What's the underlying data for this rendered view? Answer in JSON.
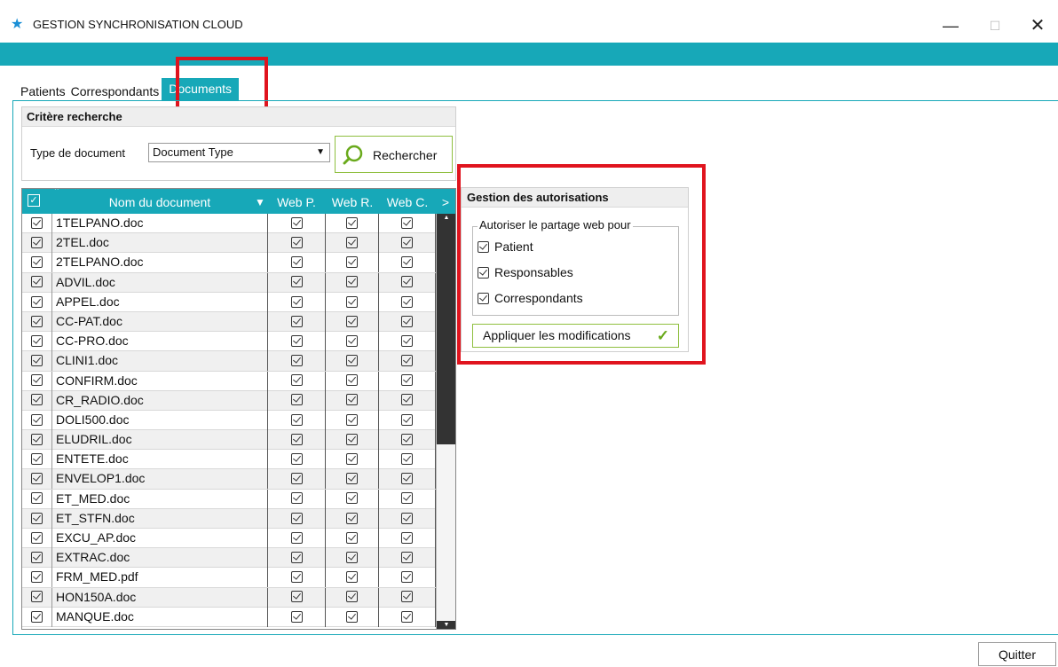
{
  "window": {
    "title": "GESTION SYNCHRONISATION CLOUD",
    "icon": "star-icon",
    "controls": {
      "minimize": "—",
      "maximize": "☐",
      "close": "✕"
    }
  },
  "colors": {
    "accent": "#17a8b8",
    "highlight": "#e0141e",
    "green": "#6aaa1c"
  },
  "tabs": [
    {
      "label": "Patients",
      "active": false
    },
    {
      "label": "Correspondants",
      "active": false
    },
    {
      "label": "Documents",
      "active": true
    }
  ],
  "search": {
    "heading": "Critère recherche",
    "type_label": "Type de document",
    "type_value": "Document Type",
    "button_label": "Rechercher"
  },
  "grid": {
    "columns": [
      "Nom du document",
      "Web P.",
      "Web R.",
      "Web C."
    ],
    "more_columns": ">",
    "rows": [
      "1TELPANO.doc",
      "2TEL.doc",
      "2TELPANO.doc",
      "ADVIL.doc",
      "APPEL.doc",
      "CC-PAT.doc",
      "CC-PRO.doc",
      "CLINI1.doc",
      "CONFIRM.doc",
      "CR_RADIO.doc",
      "DOLI500.doc",
      "ELUDRIL.doc",
      "ENTETE.doc",
      "ENVELOP1.doc",
      "ET_MED.doc",
      "ET_STFN.doc",
      "EXCU_AP.doc",
      "EXTRAC.doc",
      "FRM_MED.pdf",
      "HON150A.doc",
      "MANQUE.doc"
    ]
  },
  "auth": {
    "heading": "Gestion des autorisations",
    "legend": "Autoriser le partage web pour",
    "options": [
      "Patient",
      "Responsables",
      "Correspondants"
    ],
    "apply_label": "Appliquer les modifications",
    "apply_icon": "checkmark-icon"
  },
  "footer": {
    "quit_label": "Quitter"
  }
}
